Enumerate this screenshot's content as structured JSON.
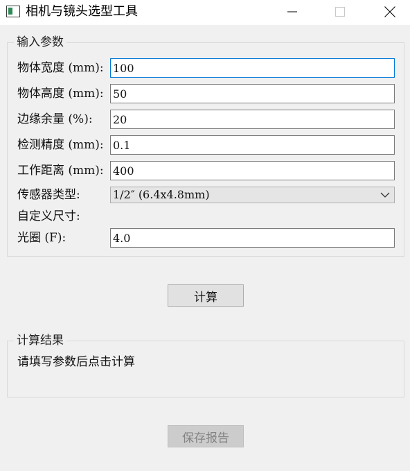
{
  "window": {
    "title": "相机与镜头选型工具",
    "icons": [
      "app-window-icon",
      "minimize-icon",
      "maximize-icon",
      "close-icon"
    ]
  },
  "input_group": {
    "title": "输入参数",
    "fields": {
      "width": {
        "label": "物体宽度 (mm):",
        "value": "100"
      },
      "height": {
        "label": "物体高度 (mm):",
        "value": "50"
      },
      "margin": {
        "label": "边缘余量 (%):",
        "value": "20"
      },
      "precision": {
        "label": "检测精度 (mm):",
        "value": "0.1"
      },
      "distance": {
        "label": "工作距离 (mm):",
        "value": "400"
      },
      "sensor": {
        "label": "传感器类型:",
        "selected": "1/2″ (6.4x4.8mm)"
      },
      "custom_size": {
        "label": "自定义尺寸:"
      },
      "aperture": {
        "label": "光圈 (F):",
        "value": "4.0"
      }
    }
  },
  "actions": {
    "calculate_label": "计算",
    "save_report_label": "保存报告"
  },
  "result_group": {
    "title": "计算结果",
    "message": "请填写参数后点击计算"
  },
  "colors": {
    "window_bg": "#f0f0f0",
    "titlebar_bg": "#ffffff",
    "focus_border": "#0078d7",
    "icon_accent": "#2e8b57"
  }
}
